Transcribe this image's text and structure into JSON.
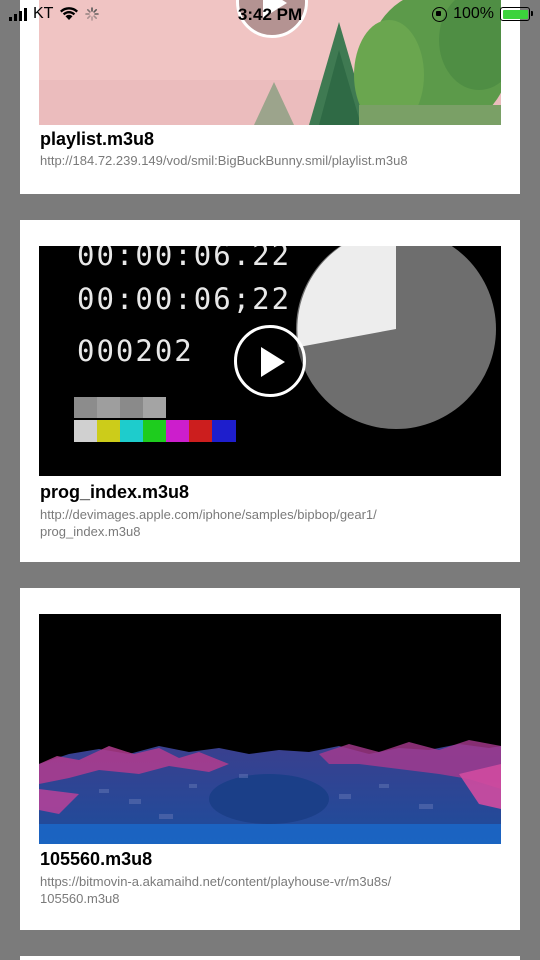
{
  "status_bar": {
    "carrier": "KT",
    "time": "3:42 PM",
    "battery": "100%",
    "battery_color": "#3cd33c"
  },
  "videos": [
    {
      "title": "playlist.m3u8",
      "url": "http://184.72.239.149/vod/smil:BigBuckBunny.smil/playlist.m3u8"
    },
    {
      "title": "prog_index.m3u8",
      "url_line1": "http://devimages.apple.com/iphone/samples/bipbop/gear1/",
      "url_line2": "prog_index.m3u8",
      "timecode_1": "00:00:06.22",
      "timecode_2": "00:00:06;22",
      "frame_count": "000202"
    },
    {
      "title": "105560.m3u8",
      "url_line1": "https://bitmovin-a.akamaihd.net/content/playhouse-vr/m3u8s/",
      "url_line2": "105560.m3u8"
    }
  ],
  "icons": {
    "play": "play-icon"
  }
}
